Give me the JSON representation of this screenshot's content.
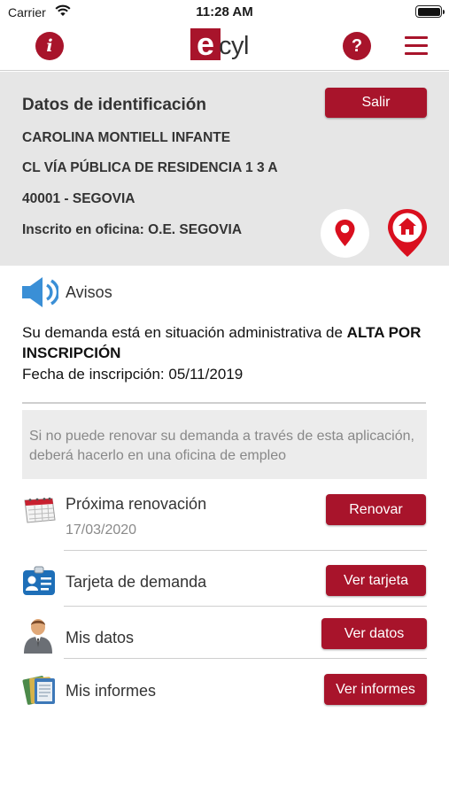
{
  "status_bar": {
    "carrier": "Carrier",
    "time": "11:28 AM"
  },
  "nav": {
    "info_glyph": "i",
    "logo_e": "e",
    "logo_text": "cyl",
    "help_glyph": "?"
  },
  "identification": {
    "title": "Datos de identificación",
    "exit_label": "Salir",
    "name": "CAROLINA MONTIELL INFANTE",
    "address": "CL VÍA PÚBLICA DE RESIDENCIA 1 3 A",
    "city": "40001 - SEGOVIA",
    "office": "Inscrito en oficina: O.E. SEGOVIA"
  },
  "avisos": {
    "label": "Avisos",
    "status_prefix": "Su demanda está en situación administrativa de ",
    "status_value": "ALTA POR INSCRIPCIÓN",
    "registration_date": "Fecha de inscripción: 05/11/2019",
    "renew_notice": "Si no puede renovar su demanda a través de esta aplicación, deberá hacerlo en una oficina de empleo"
  },
  "rows": [
    {
      "label": "Próxima renovación",
      "sublabel": "17/03/2020",
      "button": "Renovar",
      "icon": "calendar-icon"
    },
    {
      "label": "Tarjeta de demanda",
      "button": "Ver tarjeta",
      "icon": "id-card-icon"
    },
    {
      "label": "Mis datos",
      "button": "Ver datos",
      "icon": "person-icon"
    },
    {
      "label": "Mis informes",
      "button": "Ver informes",
      "icon": "reports-icon"
    }
  ],
  "colors": {
    "accent": "#a8142b",
    "panel_bg": "#e6e6e6",
    "speaker_blue": "#3a8fd6"
  }
}
